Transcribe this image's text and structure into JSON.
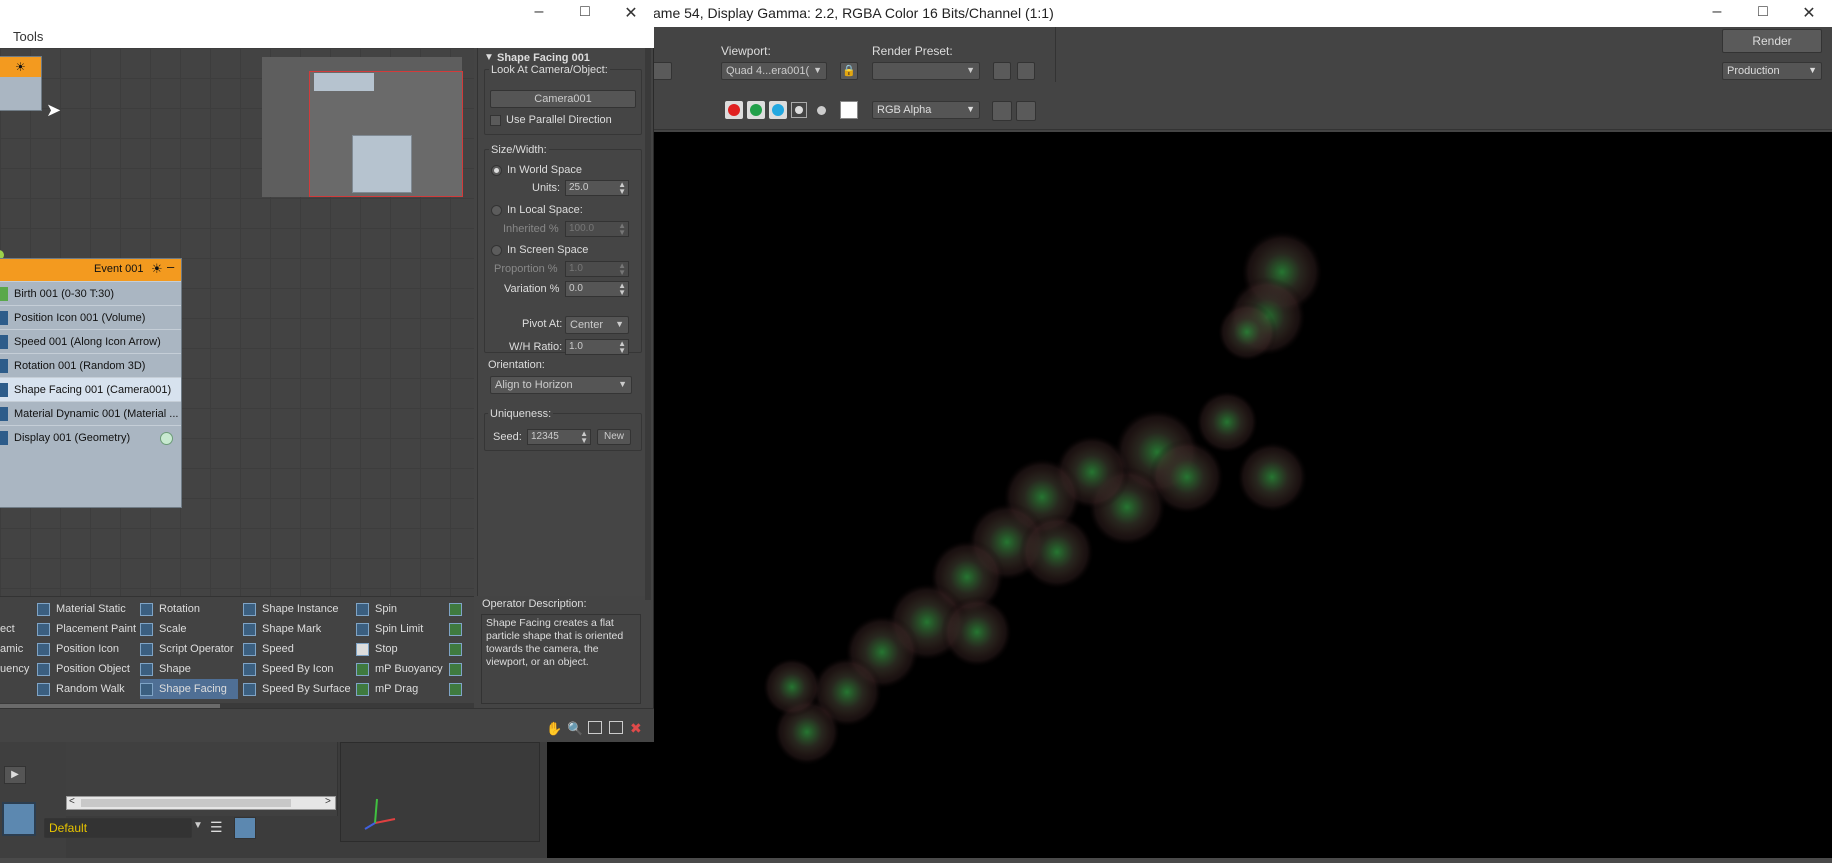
{
  "render_window": {
    "title": "ame 54, Display Gamma: 2.2, RGBA Color 16 Bits/Channel (1:1)",
    "viewport_label": "Viewport:",
    "viewport_value": "Quad 4...era001(",
    "render_preset_label": "Render Preset:",
    "render_preset_value": "",
    "render_button": "Render",
    "production_value": "Production",
    "channel_value": "RGB Alpha",
    "colors": {
      "red": "#e02020",
      "green": "#22a04a",
      "blue": "#23a8e0"
    }
  },
  "particle_view": {
    "menu_tools": "Tools",
    "event": {
      "title": "Event 001",
      "operators": [
        "Birth 001 (0-30 T:30)",
        "Position Icon 001 (Volume)",
        "Speed 001 (Along Icon Arrow)",
        "Rotation 001 (Random 3D)",
        "Shape Facing 001 (Camera001)",
        "Material Dynamic 001 (Material ...",
        "Display 001 (Geometry)"
      ]
    },
    "params": {
      "rollup_title": "Shape Facing 001",
      "look_at_label": "Look At Camera/Object:",
      "look_at_button": "Camera001",
      "use_parallel": "Use Parallel Direction",
      "size_width_label": "Size/Width:",
      "in_world_space": "In World Space",
      "units_label": "Units:",
      "units_value": "25.0",
      "in_local_space": "In Local Space:",
      "inherited_label": "Inherited %",
      "inherited_value": "100.0",
      "in_screen_space": "In Screen Space",
      "proportion_label": "Proportion %",
      "proportion_value": "1.0",
      "variation_label": "Variation %",
      "variation_value": "0.0",
      "pivot_at_label": "Pivot At:",
      "pivot_at_value": "Center",
      "wh_ratio_label": "W/H Ratio:",
      "wh_ratio_value": "1.0",
      "orientation_label": "Orientation:",
      "orientation_value": "Align to Horizon",
      "uniqueness_label": "Uniqueness:",
      "seed_label": "Seed:",
      "seed_value": "12345",
      "new_button": "New"
    },
    "depot": {
      "col0": [
        "ect",
        "amic",
        "uency"
      ],
      "col1": [
        "Material Static",
        "Placement Paint",
        "Position Icon",
        "Position Object",
        "Random Walk"
      ],
      "col2": [
        "Rotation",
        "Scale",
        "Script Operator",
        "Shape",
        "Shape Facing"
      ],
      "col3": [
        "Shape Instance",
        "Shape Mark",
        "Speed",
        "Speed By Icon",
        "Speed By Surface"
      ],
      "col4": [
        "Spin",
        "Spin Limit",
        "Stop",
        "mP Buoyancy",
        "mP Drag"
      ]
    },
    "description": {
      "title": "Operator Description:",
      "text": "Shape Facing creates a flat particle shape that is oriented towards the camera, the viewport, or an object."
    }
  },
  "max_lower": {
    "layer_value": "Default"
  }
}
